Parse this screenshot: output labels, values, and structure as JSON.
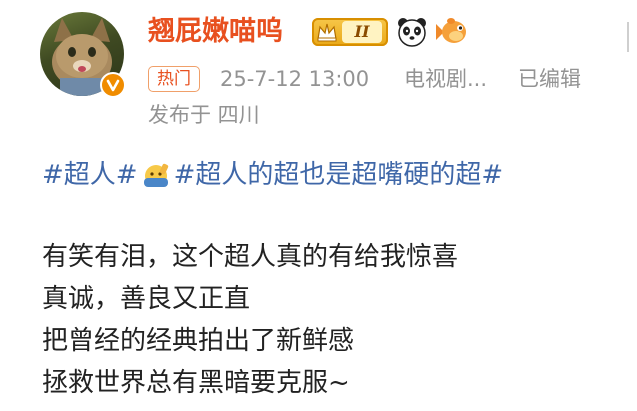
{
  "user": {
    "name": "翘屁嫩喵呜",
    "vip_level": "II",
    "avatar_icon": "cat-avatar",
    "verified_icon": "verified-v-icon"
  },
  "post_meta": {
    "tag": "热门",
    "time": "25-7-12 13:00",
    "source": "电视剧...",
    "edited": "已编辑",
    "location": "发布于 四川"
  },
  "content": {
    "hashtag_1": "#超人#",
    "hashtag_emoji_icon": "salute-face-icon",
    "hashtag_2": "#超人的超也是超嘴硬的超#",
    "lines": [
      "有笑有泪，这个超人真的有给我惊喜",
      "真诚，善良又正直",
      "把曾经的经典拍出了新鲜感",
      "拯救世界总有黑暗要克服~"
    ]
  },
  "colors": {
    "username": "#e8501f",
    "hashtag": "#3f67a8",
    "meta": "#939393",
    "body": "#222222"
  }
}
